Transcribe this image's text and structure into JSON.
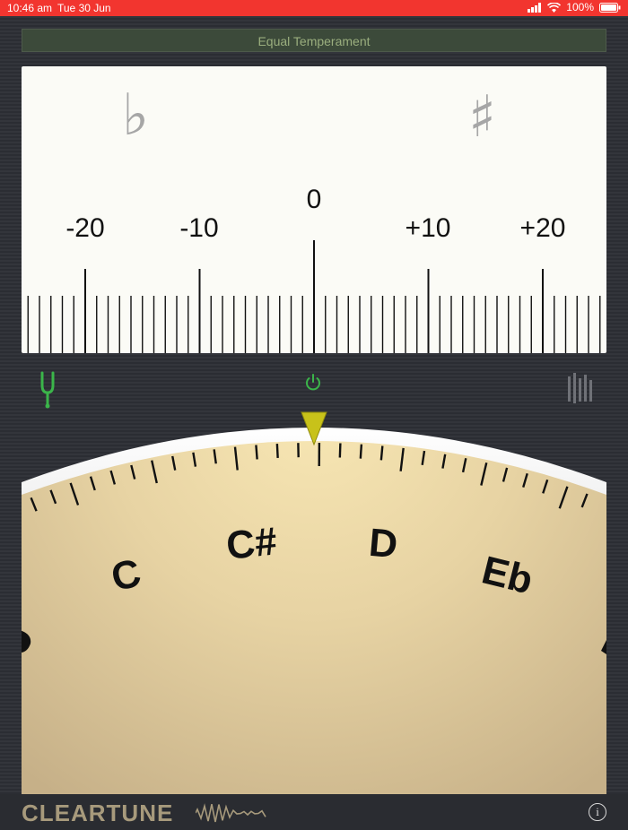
{
  "status_bar": {
    "time": "10:46 am",
    "date": "Tue 30 Jun",
    "battery": "100%"
  },
  "temperament": {
    "label": "Equal Temperament"
  },
  "meter": {
    "flat_symbol": "♭",
    "sharp_symbol": "♯",
    "scale": {
      "minus20": "-20",
      "minus10": "-10",
      "zero": "0",
      "plus10": "+10",
      "plus20": "+20"
    }
  },
  "dial": {
    "notes": [
      "C",
      "C#",
      "D",
      "Eb"
    ]
  },
  "footer": {
    "logo": "CLEARTUNE",
    "info": "i"
  },
  "colors": {
    "status_bar": "#f2352f",
    "accent_green": "#3bb54a",
    "pointer": "#c8c21a",
    "dial_face": "#e8d6a6"
  },
  "icons": {
    "tuning_fork": "tuning-fork-icon",
    "power": "power-icon",
    "bars": "bars-icon",
    "info": "info-icon"
  }
}
